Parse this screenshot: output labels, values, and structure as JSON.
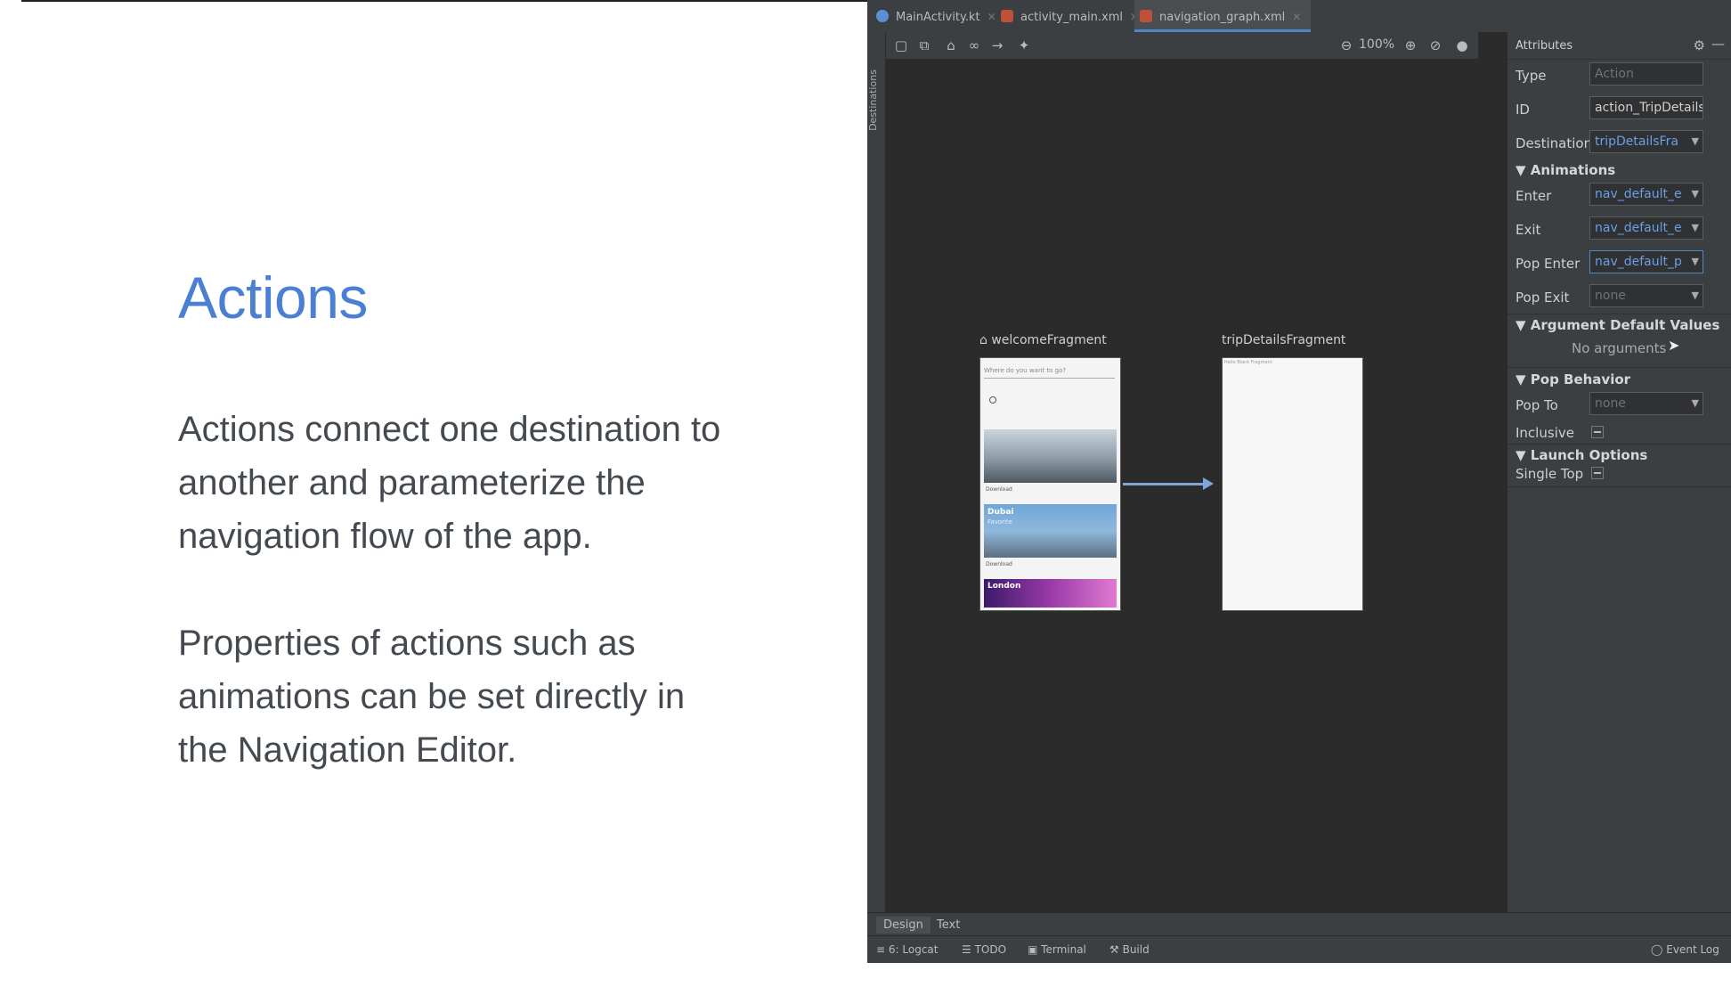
{
  "slide": {
    "title": "Actions",
    "para1": "Actions connect one destination to another and parameterize the navigation flow of the app.",
    "para2": "Properties of actions such as animations can be set directly in the Navigation Editor.",
    "title_color": "#4a7fd4"
  },
  "ide": {
    "tabs": [
      {
        "label": "MainActivity.kt",
        "icon": "kotlin-file-icon"
      },
      {
        "label": "activity_main.xml",
        "icon": "xml-layout-icon"
      },
      {
        "label": "navigation_graph.xml",
        "icon": "xml-navigation-icon",
        "active": true
      }
    ],
    "side_panel_label": "Destinations",
    "zoom_label": "100%",
    "destinations": {
      "welcome": "welcomeFragment",
      "trip": "tripDetailsFragment"
    },
    "phone": {
      "search_placeholder": "Where do you want to go?",
      "cards": [
        {
          "city": "",
          "action": "Download"
        },
        {
          "city": "Dubai",
          "subtitle": "Favorite",
          "action": "Download"
        },
        {
          "city": "London"
        }
      ],
      "trip_text": "Hello Blank Fragment"
    },
    "attributes": {
      "title": "Attributes",
      "type_label": "Type",
      "type_value": "Action",
      "id_label": "ID",
      "id_value": "action_TripDetails",
      "destination_label": "Destination",
      "destination_value": "tripDetailsFra",
      "animations_section": "Animations",
      "enter_label": "Enter",
      "enter_value": "nav_default_e",
      "exit_label": "Exit",
      "exit_value": "nav_default_e",
      "pop_enter_label": "Pop Enter",
      "pop_enter_value": "nav_default_p",
      "pop_exit_label": "Pop Exit",
      "pop_exit_value": "none",
      "args_section": "Argument Default Values",
      "no_args": "No arguments",
      "pop_behavior_section": "Pop Behavior",
      "pop_to_label": "Pop To",
      "pop_to_value": "none",
      "inclusive_label": "Inclusive",
      "launch_section": "Launch Options",
      "single_top_label": "Single Top"
    },
    "bottom_tabs": {
      "design": "Design",
      "text": "Text"
    },
    "status": {
      "logcat": "6: Logcat",
      "todo": "TODO",
      "terminal": "Terminal",
      "build": "Build",
      "event_log": "Event Log"
    },
    "accent_color": "#4a88c7"
  }
}
